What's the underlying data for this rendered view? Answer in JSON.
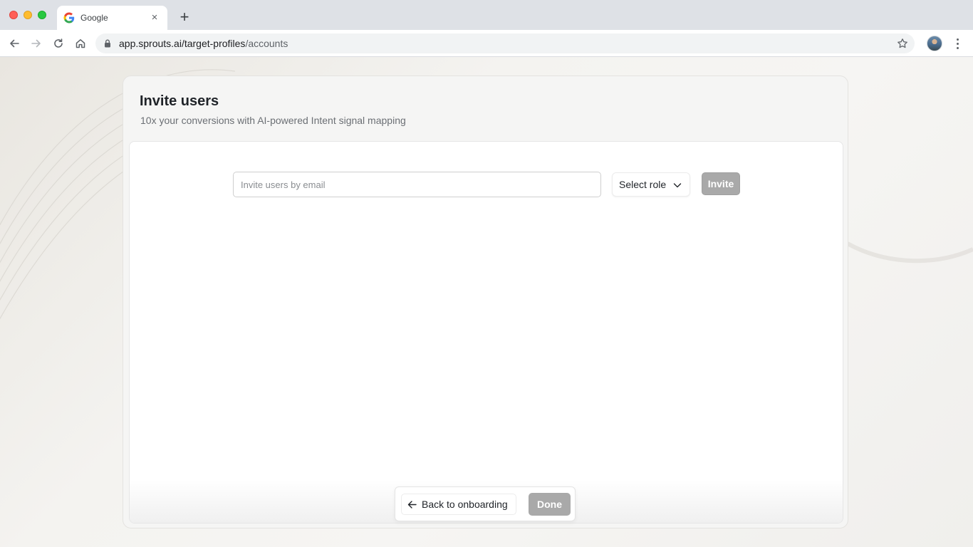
{
  "browser": {
    "tab_title": "Google",
    "tab_close": "×",
    "new_tab": "+",
    "url_host": "app.sprouts.ai/target-profiles",
    "url_path": "/accounts",
    "icons": {
      "favicon": "google-icon",
      "back": "arrow-left-icon",
      "forward": "arrow-right-icon",
      "reload": "reload-icon",
      "home": "home-icon",
      "lock": "lock-icon",
      "bookmark": "star-icon",
      "menu": "kebab-menu-icon"
    }
  },
  "card": {
    "title": "Invite users",
    "subtitle": "10x your conversions with AI-powered Intent signal mapping"
  },
  "invite_form": {
    "email_placeholder": "Invite users by email",
    "email_value": "",
    "role_label": "Select role",
    "invite_label": "Invite"
  },
  "footer": {
    "back_label": "Back to onboarding",
    "done_label": "Done"
  },
  "colors": {
    "disabled_button": "#a9a9a9",
    "traffic_red": "#ff5f57",
    "traffic_yellow": "#febc2e",
    "traffic_green": "#28c840"
  }
}
